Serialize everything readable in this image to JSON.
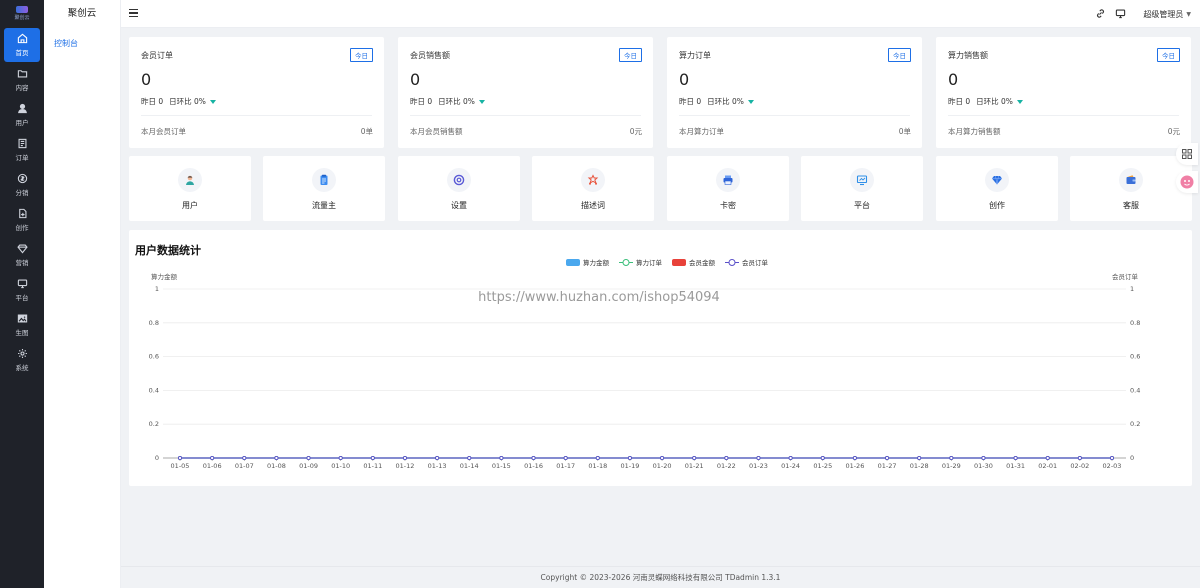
{
  "app": {
    "name": "聚创云",
    "logo_text": "聚创云"
  },
  "rail": [
    {
      "label": "首页",
      "icon": "home-icon",
      "active": true
    },
    {
      "label": "内容",
      "icon": "folder-icon",
      "active": false
    },
    {
      "label": "用户",
      "icon": "user-icon",
      "active": false
    },
    {
      "label": "订单",
      "icon": "order-icon",
      "active": false
    },
    {
      "label": "分销",
      "icon": "distribution-icon",
      "active": false
    },
    {
      "label": "创作",
      "icon": "create-icon",
      "active": false
    },
    {
      "label": "营销",
      "icon": "diamond-icon",
      "active": false
    },
    {
      "label": "平台",
      "icon": "monitor-icon",
      "active": false
    },
    {
      "label": "生图",
      "icon": "image-icon",
      "active": false
    },
    {
      "label": "系统",
      "icon": "gear-icon",
      "active": false
    }
  ],
  "subnav": {
    "items": [
      {
        "label": "控制台"
      }
    ]
  },
  "header": {
    "user": "超级管理员"
  },
  "stats": [
    {
      "title": "会员订单",
      "badge": "今日",
      "value": "0",
      "yesterday": "昨日 0",
      "ratio": "日环比 0%",
      "month_label": "本月会员订单",
      "month_value": "0单"
    },
    {
      "title": "会员销售额",
      "badge": "今日",
      "value": "0",
      "yesterday": "昨日 0",
      "ratio": "日环比 0%",
      "month_label": "本月会员销售额",
      "month_value": "0元"
    },
    {
      "title": "算力订单",
      "badge": "今日",
      "value": "0",
      "yesterday": "昨日 0",
      "ratio": "日环比 0%",
      "month_label": "本月算力订单",
      "month_value": "0单"
    },
    {
      "title": "算力销售额",
      "badge": "今日",
      "value": "0",
      "yesterday": "昨日 0",
      "ratio": "日环比 0%",
      "month_label": "本月算力销售额",
      "month_value": "0元"
    }
  ],
  "tiles": [
    {
      "label": "用户",
      "icon": "user-avatar-icon",
      "color": "#2a9df4"
    },
    {
      "label": "流量主",
      "icon": "clipboard-icon",
      "color": "#2a7de1"
    },
    {
      "label": "设置",
      "icon": "settings-ring-icon",
      "color": "#5b5bd6"
    },
    {
      "label": "描述词",
      "icon": "prompt-icon",
      "color": "#e8553e"
    },
    {
      "label": "卡密",
      "icon": "printer-icon",
      "color": "#3f6fe0"
    },
    {
      "label": "平台",
      "icon": "platform-icon",
      "color": "#2f8fe8"
    },
    {
      "label": "创作",
      "icon": "gem-icon",
      "color": "#2a6fe0"
    },
    {
      "label": "客服",
      "icon": "wallet-icon",
      "color": "#3a6fd8"
    }
  ],
  "chart_data": {
    "type": "line",
    "title": "用户数据统计",
    "y_left_label": "算力金额",
    "y_right_label": "会员订单",
    "ylim": [
      0,
      1
    ],
    "y_ticks": [
      "0",
      "0.2",
      "0.4",
      "0.6",
      "0.8",
      "1"
    ],
    "categories": [
      "01-05",
      "01-06",
      "01-07",
      "01-08",
      "01-09",
      "01-10",
      "01-11",
      "01-12",
      "01-13",
      "01-14",
      "01-15",
      "01-16",
      "01-17",
      "01-18",
      "01-19",
      "01-20",
      "01-21",
      "01-22",
      "01-23",
      "01-24",
      "01-25",
      "01-26",
      "01-27",
      "01-28",
      "01-29",
      "01-30",
      "01-31",
      "02-01",
      "02-02",
      "02-03"
    ],
    "legend": [
      {
        "name": "算力金额",
        "kind": "bar",
        "color": "#4aa8ee"
      },
      {
        "name": "算力订单",
        "kind": "line",
        "color": "#3bbf7a"
      },
      {
        "name": "会员金额",
        "kind": "bar",
        "color": "#e8423a"
      },
      {
        "name": "会员订单",
        "kind": "line",
        "color": "#5a4fc8"
      }
    ],
    "series": [
      {
        "name": "算力金额",
        "values": [
          0,
          0,
          0,
          0,
          0,
          0,
          0,
          0,
          0,
          0,
          0,
          0,
          0,
          0,
          0,
          0,
          0,
          0,
          0,
          0,
          0,
          0,
          0,
          0,
          0,
          0,
          0,
          0,
          0,
          0
        ]
      },
      {
        "name": "算力订单",
        "values": [
          0,
          0,
          0,
          0,
          0,
          0,
          0,
          0,
          0,
          0,
          0,
          0,
          0,
          0,
          0,
          0,
          0,
          0,
          0,
          0,
          0,
          0,
          0,
          0,
          0,
          0,
          0,
          0,
          0,
          0
        ]
      },
      {
        "name": "会员金额",
        "values": [
          0,
          0,
          0,
          0,
          0,
          0,
          0,
          0,
          0,
          0,
          0,
          0,
          0,
          0,
          0,
          0,
          0,
          0,
          0,
          0,
          0,
          0,
          0,
          0,
          0,
          0,
          0,
          0,
          0,
          0
        ]
      },
      {
        "name": "会员订单",
        "values": [
          0,
          0,
          0,
          0,
          0,
          0,
          0,
          0,
          0,
          0,
          0,
          0,
          0,
          0,
          0,
          0,
          0,
          0,
          0,
          0,
          0,
          0,
          0,
          0,
          0,
          0,
          0,
          0,
          0,
          0
        ]
      }
    ],
    "grid": true,
    "legend_position": "top-center"
  },
  "watermark": "https://www.huzhan.com/ishop54094",
  "footer": {
    "copyright": "Copyright © 2023-2026 河南灵蝶网络科技有限公司  TDadmin 1.3.1"
  }
}
